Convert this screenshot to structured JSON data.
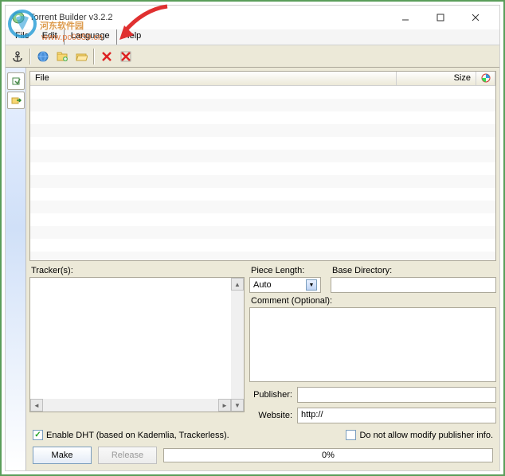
{
  "title": "Torrent Builder v3.2.2",
  "menu": {
    "file": "File",
    "edit": "Edit",
    "language": "Language",
    "help": "Help"
  },
  "filelist": {
    "col_file": "File",
    "col_size": "Size"
  },
  "labels": {
    "trackers": "Tracker(s):",
    "piece_length": "Piece Length:",
    "base_directory": "Base Directory:",
    "comment": "Comment (Optional):",
    "publisher": "Publisher:",
    "website": "Website:"
  },
  "values": {
    "piece_length": "Auto",
    "base_directory": "",
    "comment": "",
    "publisher": "",
    "website": "http://"
  },
  "checks": {
    "enable_dht": "Enable DHT (based on Kademlia, Trackerless).",
    "dont_modify": "Do not allow modify publisher info."
  },
  "buttons": {
    "make": "Make",
    "release": "Release"
  },
  "progress": "0%",
  "watermark_text": "河东软件园",
  "watermark_url": "www.pc0359.cn"
}
